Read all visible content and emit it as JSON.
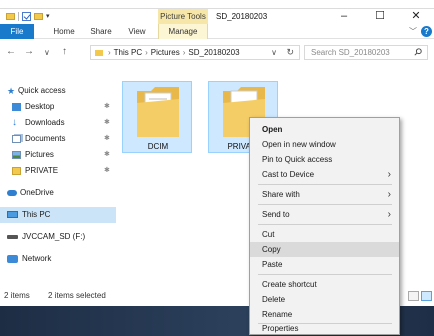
{
  "window": {
    "title": "SD_20180203",
    "contextual_tab_group": "Picture Tools"
  },
  "ribbon": {
    "tabs": [
      "File",
      "Home",
      "Share",
      "View",
      "Manage"
    ]
  },
  "address": {
    "breadcrumb": [
      "This PC",
      "Pictures",
      "SD_20180203"
    ],
    "search_placeholder": "Search SD_20180203"
  },
  "sidebar": {
    "items": [
      {
        "label": "Quick access",
        "icon": "star-icon"
      },
      {
        "label": "Desktop",
        "icon": "desktop-icon"
      },
      {
        "label": "Downloads",
        "icon": "download-icon"
      },
      {
        "label": "Documents",
        "icon": "documents-icon"
      },
      {
        "label": "Pictures",
        "icon": "pictures-icon"
      },
      {
        "label": "PRIVATE",
        "icon": "folder-icon"
      },
      {
        "label": "OneDrive",
        "icon": "cloud-icon"
      },
      {
        "label": "This PC",
        "icon": "computer-icon"
      },
      {
        "label": "JVCCAM_SD (F:)",
        "icon": "drive-icon"
      },
      {
        "label": "Network",
        "icon": "network-icon"
      }
    ]
  },
  "content": {
    "items": [
      {
        "label": "DCIM"
      },
      {
        "label": "PRIVATE"
      }
    ]
  },
  "context_menu": {
    "items": [
      {
        "label": "Open"
      },
      {
        "label": "Open in new window"
      },
      {
        "label": "Pin to Quick access"
      },
      {
        "label": "Cast to Device"
      },
      {
        "label": "Share with"
      },
      {
        "label": "Send to"
      },
      {
        "label": "Cut"
      },
      {
        "label": "Copy"
      },
      {
        "label": "Paste"
      },
      {
        "label": "Create shortcut"
      },
      {
        "label": "Delete"
      },
      {
        "label": "Rename"
      },
      {
        "label": "Properties"
      }
    ]
  },
  "status": {
    "item_count": "2 items",
    "selected": "2 items selected"
  },
  "colors": {
    "file_tab": "#1979ca",
    "selection": "#cde8ff",
    "contextual_tab": "#f6e7a8",
    "taskbar": "#1d2d44"
  }
}
